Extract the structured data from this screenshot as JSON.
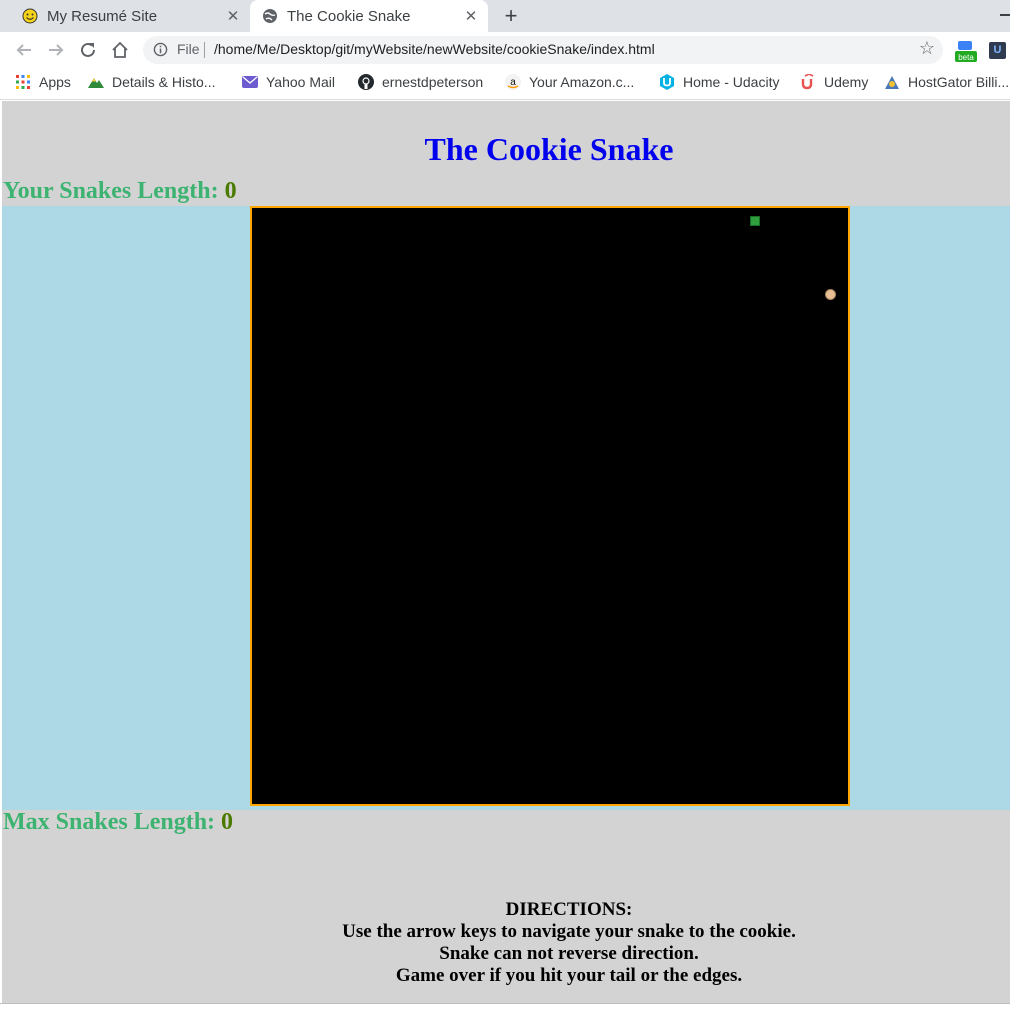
{
  "browser": {
    "tabs": [
      {
        "title": "My Resumé Site",
        "icon": "smiley-icon",
        "active": false
      },
      {
        "title": "The Cookie Snake",
        "icon": "globe-icon",
        "active": true
      }
    ],
    "address": {
      "scheme_label": "File",
      "url": "/home/Me/Desktop/git/myWebsite/newWebsite/cookieSnake/index.html"
    },
    "extension_badge": "beta",
    "bookmarks": [
      {
        "label": "Apps",
        "icon": "apps-grid-icon"
      },
      {
        "label": "Details & Histo...",
        "icon": "mountain-icon"
      },
      {
        "label": "Yahoo Mail",
        "icon": "mail-icon"
      },
      {
        "label": "ernestdpeterson",
        "icon": "github-icon"
      },
      {
        "label": "Your Amazon.c...",
        "icon": "amazon-icon"
      },
      {
        "label": "Home - Udacity",
        "icon": "udacity-icon"
      },
      {
        "label": "Udemy",
        "icon": "udemy-icon"
      },
      {
        "label": "HostGator Billi...",
        "icon": "hostgator-icon"
      }
    ]
  },
  "page": {
    "title": "The Cookie Snake",
    "current_length_label": "Your Snakes Length:",
    "current_length": "0",
    "max_length_label": "Max Snakes Length:",
    "max_length": "0",
    "directions": {
      "heading": "DIRECTIONS:",
      "lines": [
        "Use the arrow keys to navigate your snake to the cookie.",
        "Snake can not reverse direction.",
        "Game over if you hit your tail or the edges."
      ]
    }
  },
  "colors": {
    "title": "#0000ee",
    "score_label": "#3cb371",
    "score_value": "#4a7a00",
    "play_area_bg": "#add8e6",
    "board_bg": "#000000",
    "board_border": "#ffa500",
    "snake": "#2e9e3f",
    "cookie": "#e6bf95"
  }
}
